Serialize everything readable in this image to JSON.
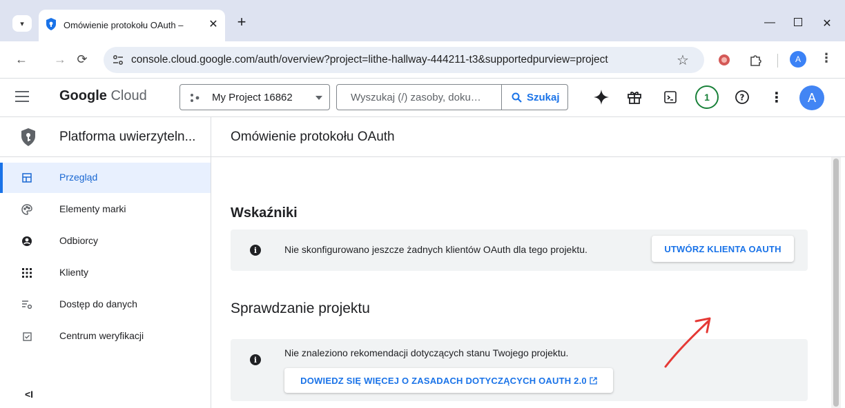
{
  "browser": {
    "tab_title": "Omówienie protokołu OAuth –",
    "url": "console.cloud.google.com/auth/overview?project=lithe-hallway-444211-t3&supportedpurview=project",
    "profile_initial": "A"
  },
  "header": {
    "logo_google": "Google",
    "logo_cloud": "Cloud",
    "project_name": "My Project 16862",
    "search_placeholder": "Wyszukaj (/) zasoby, doku…",
    "search_button": "Szukaj",
    "notification_count": "1",
    "avatar_initial": "A"
  },
  "sidebar": {
    "title": "Platforma uwierzyteln...",
    "items": [
      {
        "label": "Przegląd",
        "icon": "dashboard-icon",
        "active": true
      },
      {
        "label": "Elementy marki",
        "icon": "palette-icon",
        "active": false
      },
      {
        "label": "Odbiorcy",
        "icon": "account-circle-icon",
        "active": false
      },
      {
        "label": "Klienty",
        "icon": "apps-grid-icon",
        "active": false
      },
      {
        "label": "Dostęp do danych",
        "icon": "data-settings-icon",
        "active": false
      },
      {
        "label": "Centrum weryfikacji",
        "icon": "checkbox-icon",
        "active": false
      }
    ],
    "collapse_label": "<I"
  },
  "main": {
    "title": "Omówienie protokołu OAuth",
    "section1": {
      "heading": "Wskaźniki",
      "message": "Nie skonfigurowano jeszcze żadnych klientów OAuth dla tego projektu.",
      "button": "UTWÓRZ KLIENTA OAUTH"
    },
    "section2": {
      "heading": "Sprawdzanie projektu",
      "message": "Nie znaleziono rekomendacji dotyczących stanu Twojego projektu.",
      "link": "DOWIEDZ SIĘ WIĘCEJ O ZASADACH DOTYCZĄCYCH OAUTH 2.0"
    }
  },
  "colors": {
    "accent": "#1a73e8",
    "active_bg": "#e8f0fe",
    "card_bg": "#f1f3f4",
    "annotation_arrow": "#e53935"
  }
}
